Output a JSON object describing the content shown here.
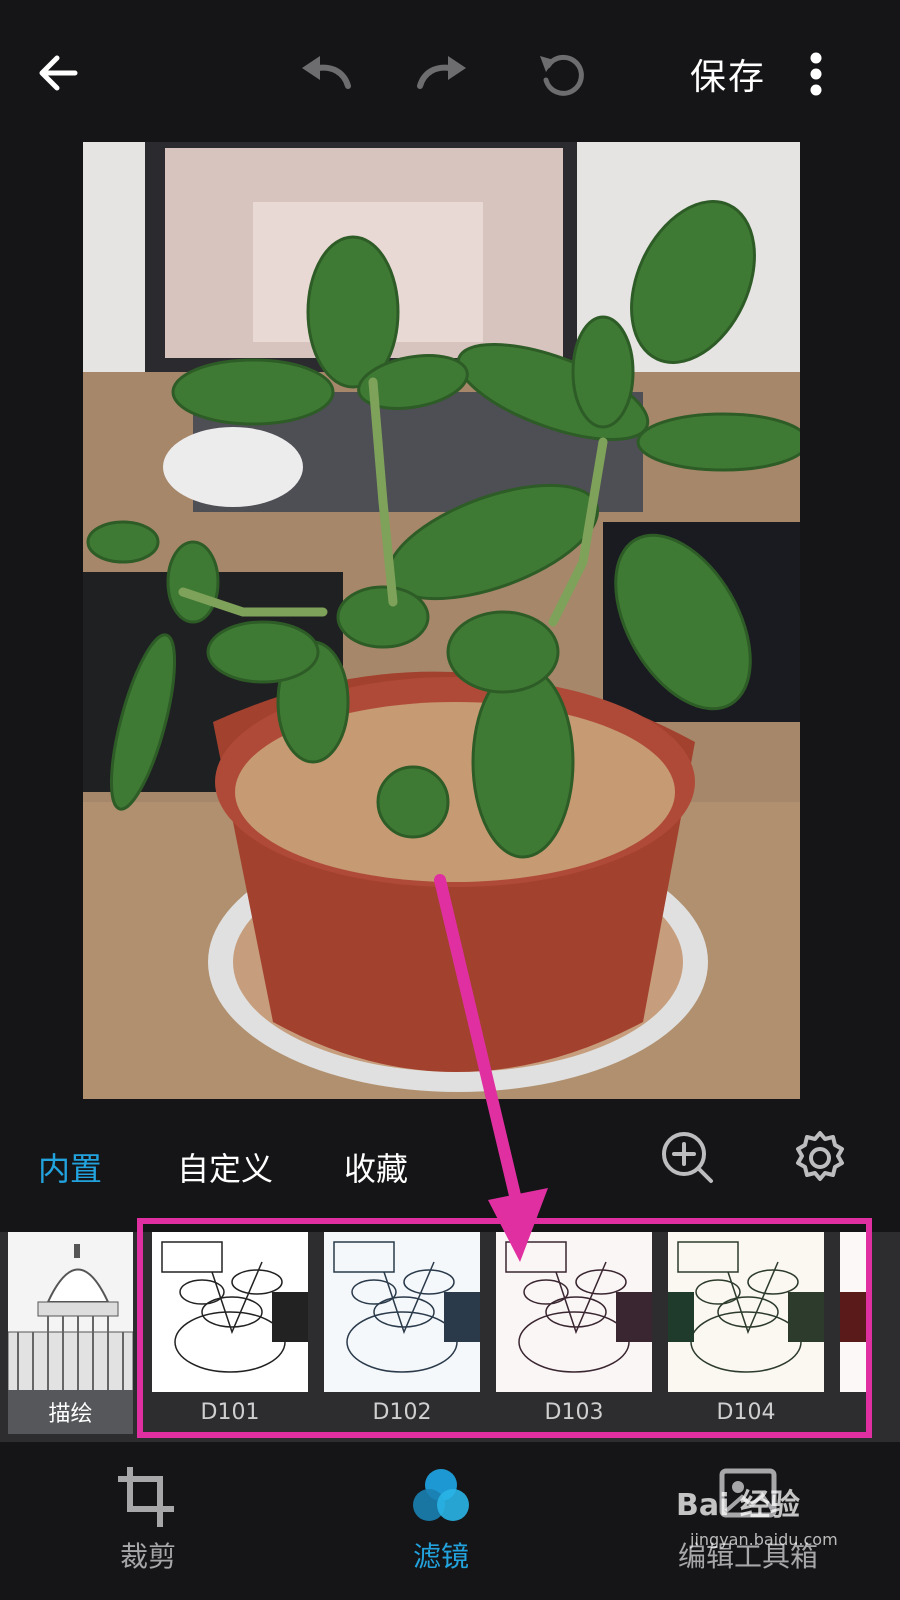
{
  "topbar": {
    "save_label": "保存",
    "icons": [
      "back-arrow-icon",
      "undo-icon",
      "redo-icon",
      "reset-icon",
      "more-vertical-icon"
    ]
  },
  "tabs": {
    "builtin": "内置",
    "custom": "自定义",
    "favorites": "收藏"
  },
  "filters": [
    {
      "label": "描绘"
    },
    {
      "label": "D101"
    },
    {
      "label": "D102"
    },
    {
      "label": "D103"
    },
    {
      "label": "D104"
    }
  ],
  "bottom_nav": {
    "crop": "裁剪",
    "filter": "滤镜",
    "tools": "编辑工具箱"
  },
  "watermark": {
    "brand": "Bai 经验",
    "url": "jingyan.baidu.com"
  },
  "colors": {
    "background": "#151517",
    "accent": "#22a3de",
    "highlight": "#e02fa0",
    "filter_strip": "#2d2d30"
  }
}
